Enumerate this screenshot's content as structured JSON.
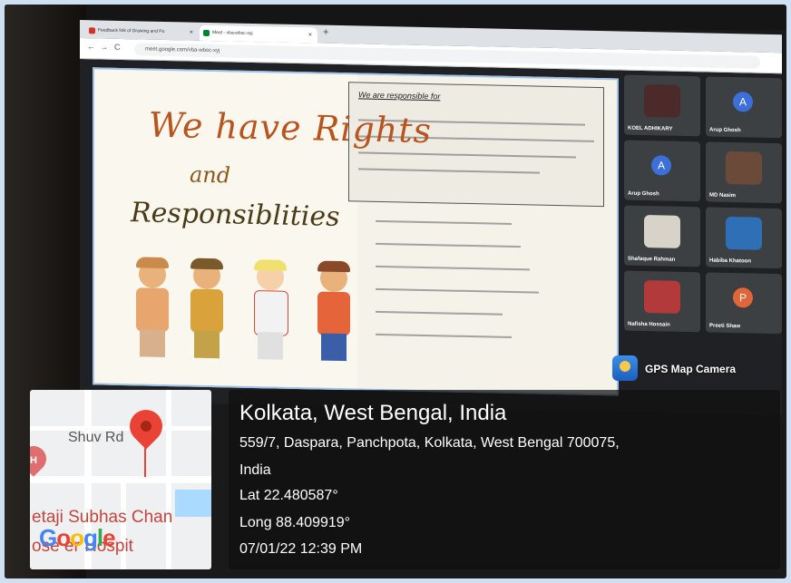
{
  "browser": {
    "tabs": [
      {
        "label": "Feedback link of Drawing and Po",
        "close": "×"
      },
      {
        "label": "Meet - vba-wbsc-xyj",
        "close": "×"
      }
    ],
    "new_tab": "+",
    "nav": {
      "back": "←",
      "forward": "→",
      "reload": "C"
    },
    "url": "meet.google.com/vba-wbsc-xyj"
  },
  "presentation": {
    "poster_line1": "We have Rights",
    "poster_line2": "and",
    "poster_line3": "Responsiblities",
    "box_title": "We are responsible for"
  },
  "participants": [
    {
      "name": "KOEL ADHIKARY",
      "type": "photo",
      "color": "#4d2a2a"
    },
    {
      "name": "Arup Ghosh",
      "type": "avatar",
      "initial": "A",
      "color": "#3c6fd8"
    },
    {
      "name": "Arup Ghosh",
      "type": "avatar",
      "initial": "A",
      "color": "#3c6fd8"
    },
    {
      "name": "MD Nasim",
      "type": "photo",
      "color": "#6b4a3a"
    },
    {
      "name": "Shafaque Rahman",
      "type": "photo",
      "color": "#d8d3c8"
    },
    {
      "name": "Habiba Khatoon",
      "type": "photo",
      "color": "#2f6fb5"
    },
    {
      "name": "Nafisha Hossain",
      "type": "photo",
      "color": "#b33a3a"
    },
    {
      "name": "Preeti Shaw",
      "type": "avatar",
      "initial": "P",
      "color": "#e0663a"
    }
  ],
  "watermark": {
    "label": "GPS Map Camera"
  },
  "map": {
    "label_road": "Shuv   Rd",
    "label_place": "etaji Subhas Chan",
    "label_hospital": "ose    er Hospit",
    "hospital_icon": "H",
    "logo": "Google"
  },
  "location": {
    "title": "Kolkata, West Bengal, India",
    "address_line1": "559/7, Daspara, Panchpota, Kolkata, West Bengal 700075,",
    "address_line2": "India",
    "lat": "Lat 22.480587°",
    "long": "Long 88.409919°",
    "datetime": "07/01/22 12:39 PM"
  }
}
